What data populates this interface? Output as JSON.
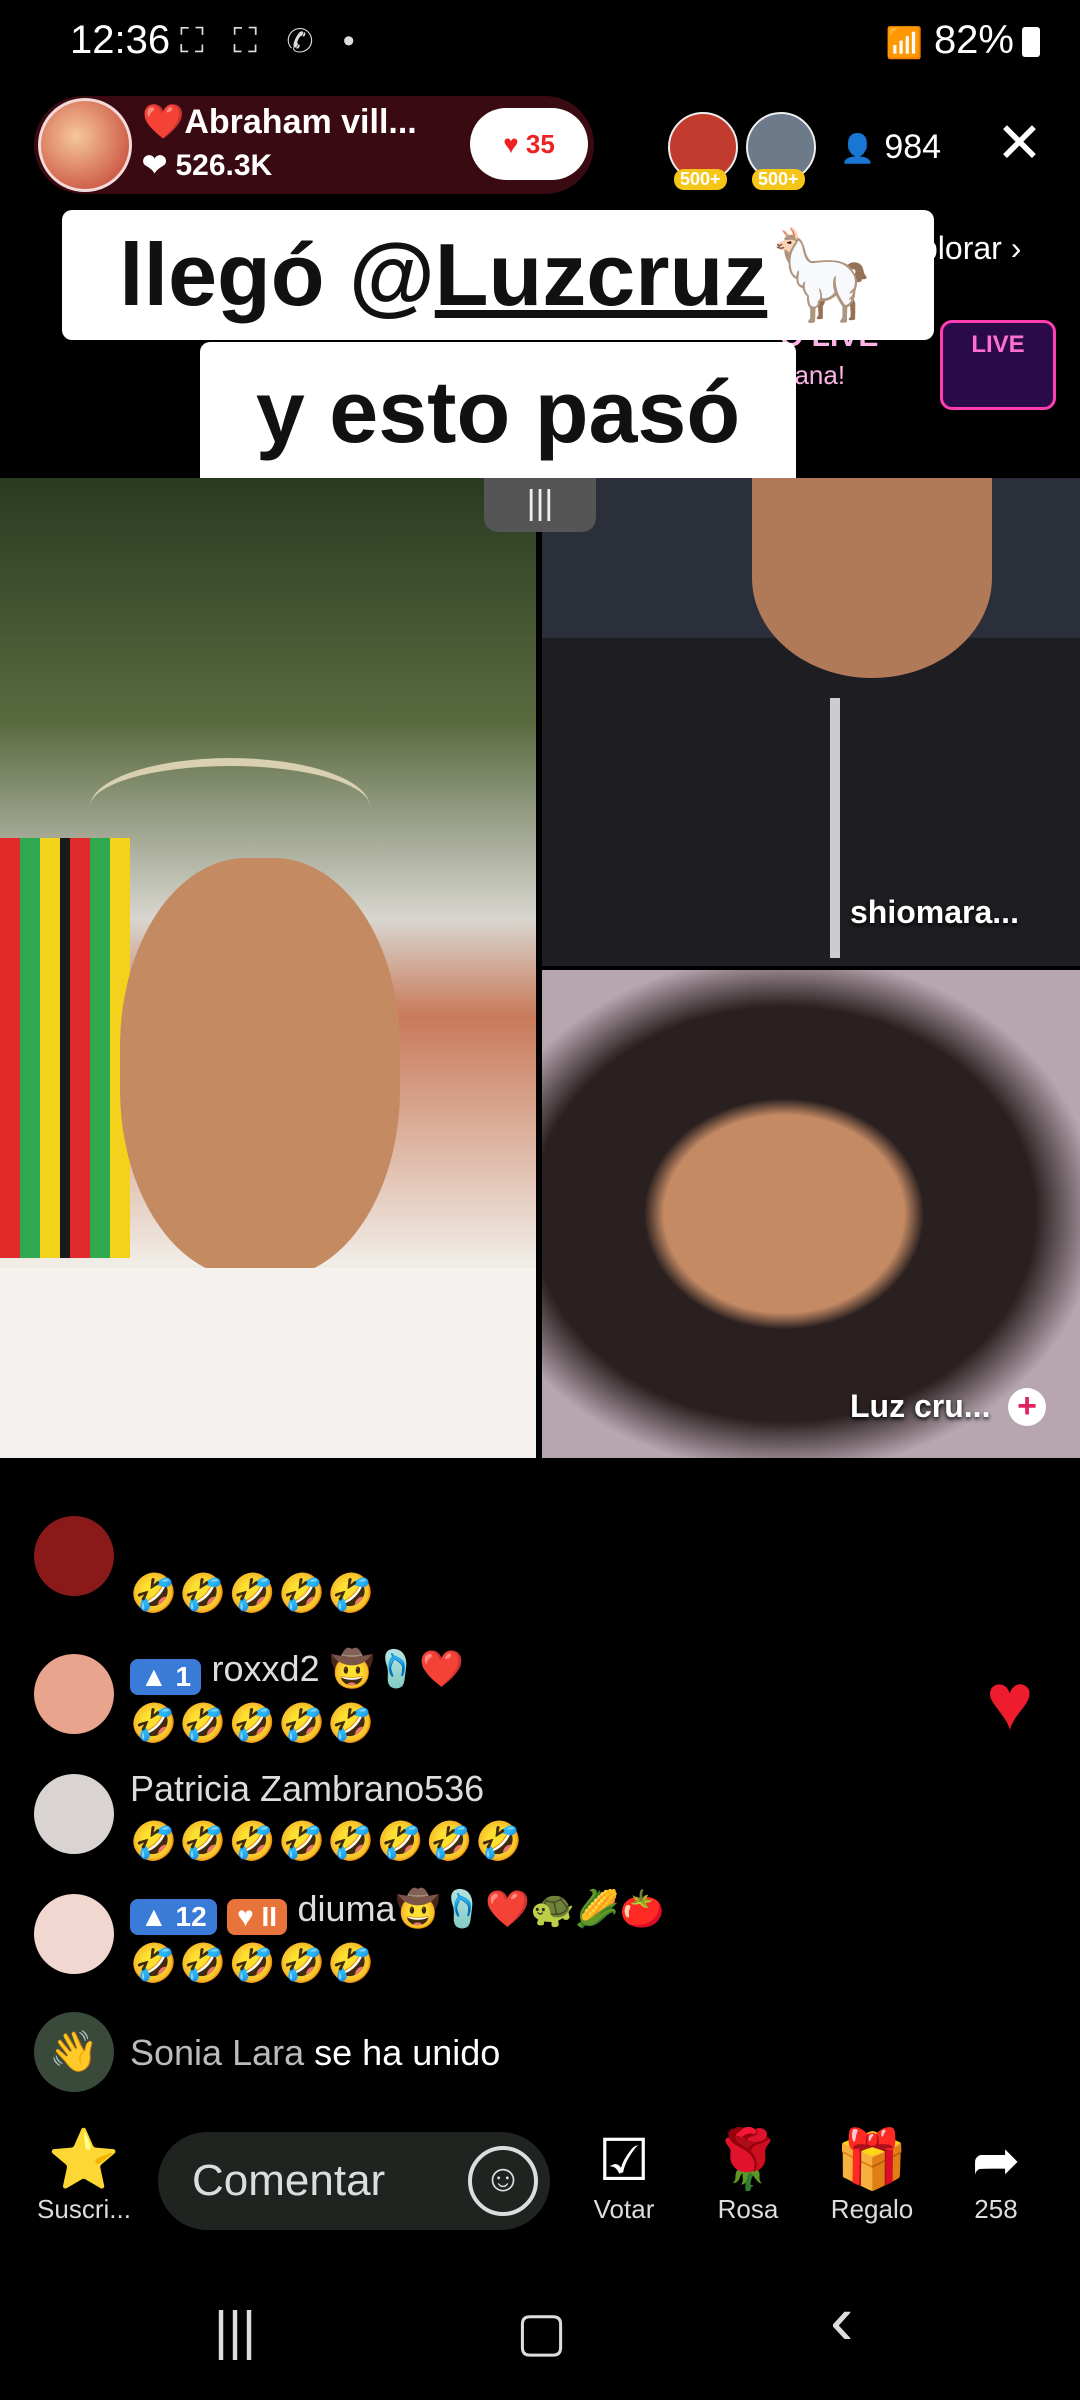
{
  "status_bar": {
    "time": "12:36",
    "icons": "⛶ ⛶ ✆ •",
    "battery": "82%",
    "signal": "📶"
  },
  "host": {
    "name": "❤️Abraham vill...",
    "likes": "❤ 526.3K",
    "heart_count": "35"
  },
  "top_viewers": [
    {
      "badge": "500+"
    },
    {
      "badge": "500+"
    }
  ],
  "viewer_count": "984",
  "close_icon": "✕",
  "explorar": "plorar ›",
  "promo": {
    "line1": "O LIVE",
    "line2": "gana!",
    "logo": "LIVE"
  },
  "caption": {
    "line1_prefix": "llegó @",
    "line1_handle": "Luzcruz",
    "line1_emoji": "🦙",
    "line2": "y esto pasó"
  },
  "panels": {
    "top_right_label": "shiomara...",
    "bottom_right_label": "Luz cru...",
    "add_icon": "+",
    "divider_tab": "|||"
  },
  "chat": [
    {
      "name": "",
      "text": "🤣🤣🤣🤣🤣"
    },
    {
      "level": "1",
      "name": "roxxd2 🤠🩴❤️",
      "text": "🤣🤣🤣🤣🤣"
    },
    {
      "name": "Patricia Zambrano536",
      "text": "🤣🤣🤣🤣🤣🤣🤣🤣"
    },
    {
      "level": "12",
      "fan": "II",
      "name": "diuma🤠🩴❤️🐢🌽🍅",
      "text": "🤣🤣🤣🤣🤣"
    }
  ],
  "join_notice": {
    "name": "Sonia Lara",
    "action": "se ha unido"
  },
  "bottom_bar": {
    "subscribe": {
      "icon": "⭐",
      "label": "Suscri..."
    },
    "comment_placeholder": "Comentar",
    "vote": {
      "icon": "☑",
      "label": "Votar"
    },
    "rose": {
      "icon": "🌹",
      "label": "Rosa"
    },
    "gift": {
      "icon": "🎁",
      "label": "Regalo"
    },
    "share": {
      "icon": "➦",
      "label": "258"
    }
  },
  "nav": {
    "recents": "|||",
    "home": "▢",
    "back": "‹"
  }
}
